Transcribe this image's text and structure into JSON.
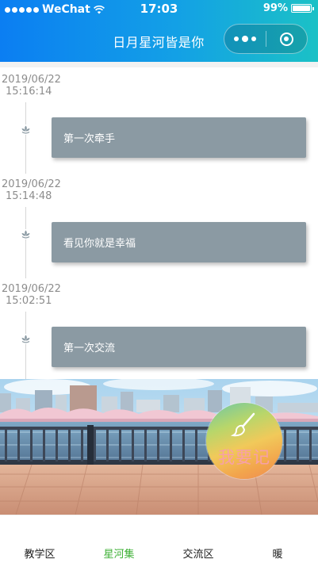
{
  "status_bar": {
    "carrier": "WeChat",
    "time": "17:03",
    "battery_text": "99%",
    "battery_level": 0.99,
    "signal_icon": "signal-dots-icon",
    "wifi_icon": "wifi-icon"
  },
  "nav": {
    "title": "日月星河皆是你",
    "more_icon": "more-dots-icon",
    "close_icon": "target-circle-icon",
    "gradient_from": "#0b7ef2",
    "gradient_to": "#1bc1c6"
  },
  "timeline": {
    "entries": [
      {
        "date": "2019/06/22",
        "time": "15:16:14",
        "text": "第一次牵手",
        "icon": "lotus-icon"
      },
      {
        "date": "2019/06/22",
        "time": "15:14:48",
        "text": "看见你就是幸福",
        "icon": "lotus-icon"
      },
      {
        "date": "2019/06/22",
        "time": "15:02:51",
        "text": "第一次交流",
        "icon": "lotus-icon"
      }
    ],
    "card_color": "#8b9aa3"
  },
  "record_button": {
    "label": "我要记",
    "icon": "brush-icon"
  },
  "tabbar": {
    "tabs": [
      {
        "label": "教学区",
        "active": false
      },
      {
        "label": "星河集",
        "active": true
      },
      {
        "label": "交流区",
        "active": false
      },
      {
        "label": "暖",
        "active": false
      }
    ],
    "active_color": "#3cb034"
  }
}
